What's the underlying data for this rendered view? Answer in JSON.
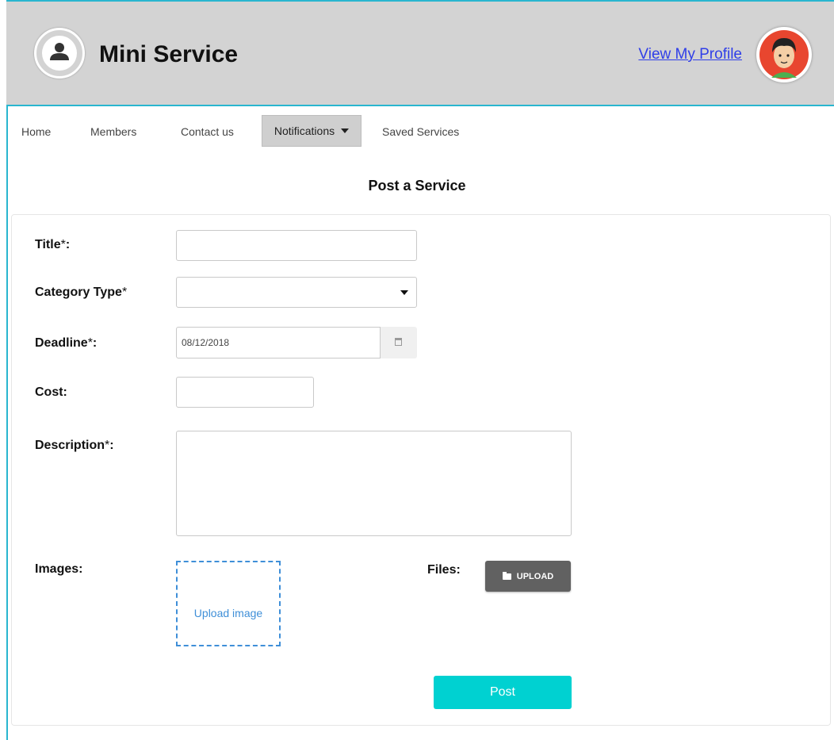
{
  "header": {
    "app_title": "Mini Service",
    "profile_link": "View My Profile",
    "logo_icon": "user-icon",
    "avatar_icon": "avatar-icon"
  },
  "nav": {
    "items": [
      "Home",
      "Members",
      "Contact us",
      "Notifications",
      "Saved Services"
    ]
  },
  "form": {
    "page_title": "Post a Service",
    "title_label": "Title",
    "category_label": "Category Type",
    "deadline_label": "Deadline",
    "deadline_value": "08/12/2018",
    "cost_label": "Cost:",
    "description_label": "Description",
    "images_label": "Images:",
    "upload_image_text": "Upload image",
    "files_label": "Files:",
    "upload_label": "UPLOAD",
    "post_label": "Post"
  },
  "colors": {
    "accent": "#00d1d1",
    "frame": "#29b6cf",
    "link": "#2f3ee8"
  }
}
